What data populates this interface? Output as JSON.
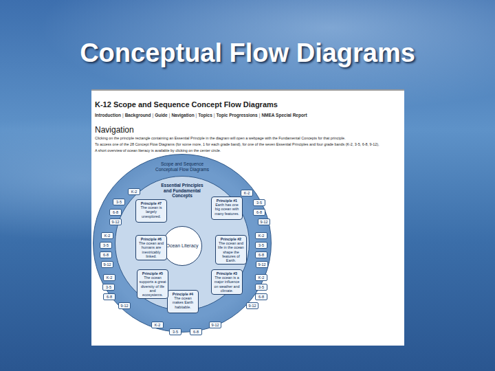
{
  "slide": {
    "title": "Conceptual Flow Diagrams"
  },
  "page": {
    "title": "K-12 Scope and Sequence Concept Flow Diagrams",
    "nav": [
      "Introduction",
      "Background",
      "Guide",
      "Navigation",
      "Topics",
      "Topic Progressions",
      "NMEA Special Report"
    ],
    "nav_separator": "|",
    "heading": "Navigation",
    "paragraphs": [
      "Clicking on the principle rectangle containing an Essential Principle in the diagram will open a webpage with the Fundamental Concepts for that principle.",
      "To access one of the 28 Concept Flow Diagrams (for some more, 1 for each grade band), for one of the seven Essential Principles and four grade bands (K-2, 3-5, 6-8, 9-12),",
      "A short overview of ocean literacy is available by clicking on the center circle."
    ]
  },
  "diagram": {
    "ring_title": "Scope and Sequence Conceptual Flow Diagrams",
    "heading": "Essential Principles and Fundamental Concepts",
    "center": "Ocean Literacy",
    "principles": [
      {
        "label": "Principle #1",
        "text": "Earth has one big ocean with many features.",
        "grades": [
          "K-2",
          "3-5",
          "6-8",
          "9-12"
        ]
      },
      {
        "label": "Principle #2",
        "text": "The ocean and life in the ocean shape the features of Earth.",
        "grades": [
          "K-2",
          "3-5",
          "6-8",
          "9-12"
        ]
      },
      {
        "label": "Principle #3",
        "text": "The ocean is a major influence on weather and climate.",
        "grades": [
          "K-2",
          "3-5",
          "6-8",
          "9-12"
        ]
      },
      {
        "label": "Principle #4",
        "text": "The ocean makes Earth habitable.",
        "grades": [
          "K-2",
          "3-5",
          "6-8",
          "9-12"
        ]
      },
      {
        "label": "Principle #5",
        "text": "The ocean supports a great diversity of life and ecosystems.",
        "grades": [
          "K-2",
          "3-5",
          "6-8",
          "9-12"
        ]
      },
      {
        "label": "Principle #6",
        "text": "The ocean and humans are inextricably linked.",
        "grades": [
          "K-2",
          "3-5",
          "6-8",
          "9-12"
        ]
      },
      {
        "label": "Principle #7",
        "text": "The ocean is largely unexplored.",
        "grades": [
          "K-2",
          "3-5",
          "6-8",
          "9-12"
        ]
      }
    ]
  }
}
